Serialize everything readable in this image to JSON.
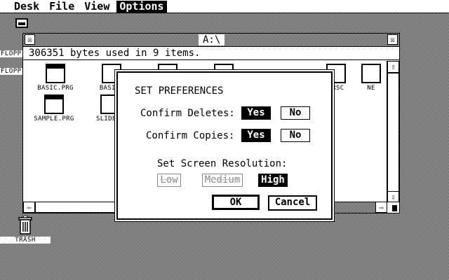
{
  "menubar": {
    "items": [
      {
        "label": "Desk"
      },
      {
        "label": "File"
      },
      {
        "label": "View"
      },
      {
        "label": "Options",
        "active": true
      }
    ]
  },
  "desktop": {
    "floppy_a_label": "FLOPP",
    "floppy_b_label": "FLOPP",
    "trash_label": "TRASH"
  },
  "window": {
    "title": "A:\\",
    "close_glyph": "☒",
    "full_glyph": "☒",
    "info": "306351 bytes used in 9 items.",
    "files": [
      {
        "name": "BASIC.PRG",
        "type": "prg"
      },
      {
        "name": "BASIC.",
        "type": "doc"
      },
      {
        "name": "",
        "type": "doc"
      },
      {
        "name": "",
        "type": "doc"
      },
      {
        "name": ".RSC",
        "type": "doc"
      },
      {
        "name": "NE",
        "type": "doc"
      },
      {
        "name": "SAMPLE.PRG",
        "type": "prg"
      },
      {
        "name": "SLIDENE",
        "type": "doc"
      }
    ],
    "scroll_up": "⇧",
    "scroll_down": "⇩",
    "scroll_left": "⇦",
    "scroll_right": "⇨"
  },
  "dialog": {
    "title": "SET PREFERENCES",
    "confirm_deletes": {
      "label": "Confirm Deletes:",
      "yes": "Yes",
      "no": "No",
      "selected": "yes"
    },
    "confirm_copies": {
      "label": "Confirm Copies:",
      "yes": "Yes",
      "no": "No",
      "selected": "yes"
    },
    "resolution": {
      "label": "Set Screen Resolution:",
      "low": "Low",
      "medium": "Medium",
      "high": "High",
      "selected": "high"
    },
    "ok": "OK",
    "cancel": "Cancel"
  }
}
